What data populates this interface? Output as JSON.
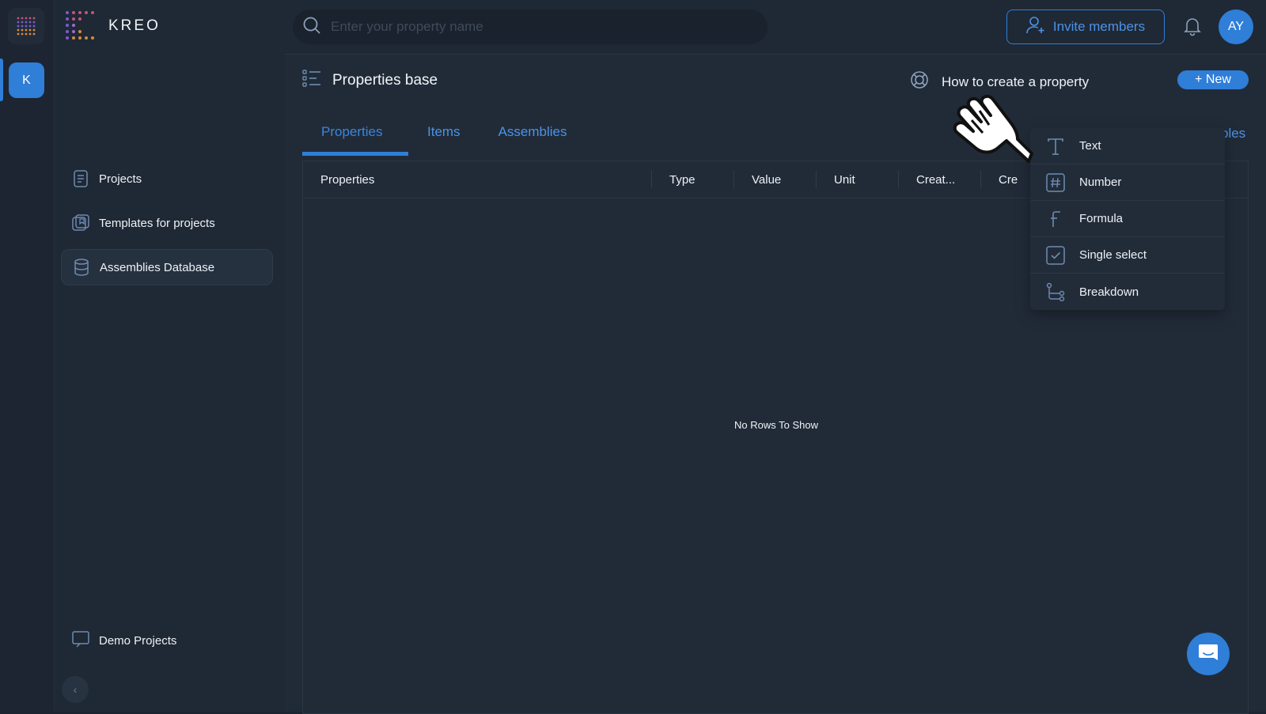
{
  "rail": {
    "workspace_initial": "K"
  },
  "brand": {
    "name": "KREO"
  },
  "sidebar": {
    "items": [
      {
        "label": "Projects",
        "icon": "document-icon"
      },
      {
        "label": "Templates for projects",
        "icon": "templates-icon"
      },
      {
        "label": "Assemblies Database",
        "icon": "database-icon",
        "active": true
      }
    ],
    "demo_label": "Demo Projects",
    "collapse_symbol": "‹"
  },
  "topbar": {
    "search_placeholder": "Enter your property name",
    "invite_label": "Invite members",
    "avatar_initials": "AY"
  },
  "page": {
    "title": "Properties base",
    "howto_label": "How to create a property",
    "new_label": "+ New",
    "tabs": [
      {
        "label": "Properties",
        "active": true
      },
      {
        "label": "Items"
      },
      {
        "label": "Assemblies"
      }
    ],
    "tab_overflow": "ples"
  },
  "grid": {
    "columns": [
      "Properties",
      "Type",
      "Value",
      "Unit",
      "Creat...",
      "Cre"
    ],
    "empty_text": "No Rows To Show"
  },
  "dropdown": {
    "items": [
      {
        "label": "Text",
        "icon": "text-type-icon"
      },
      {
        "label": "Number",
        "icon": "hash-icon"
      },
      {
        "label": "Formula",
        "icon": "formula-icon"
      },
      {
        "label": "Single select",
        "icon": "checkbox-icon"
      },
      {
        "label": "Breakdown",
        "icon": "breakdown-icon"
      }
    ]
  },
  "colors": {
    "accent": "#2f7ed8",
    "background": "#1b2430",
    "panel": "#212b38"
  }
}
